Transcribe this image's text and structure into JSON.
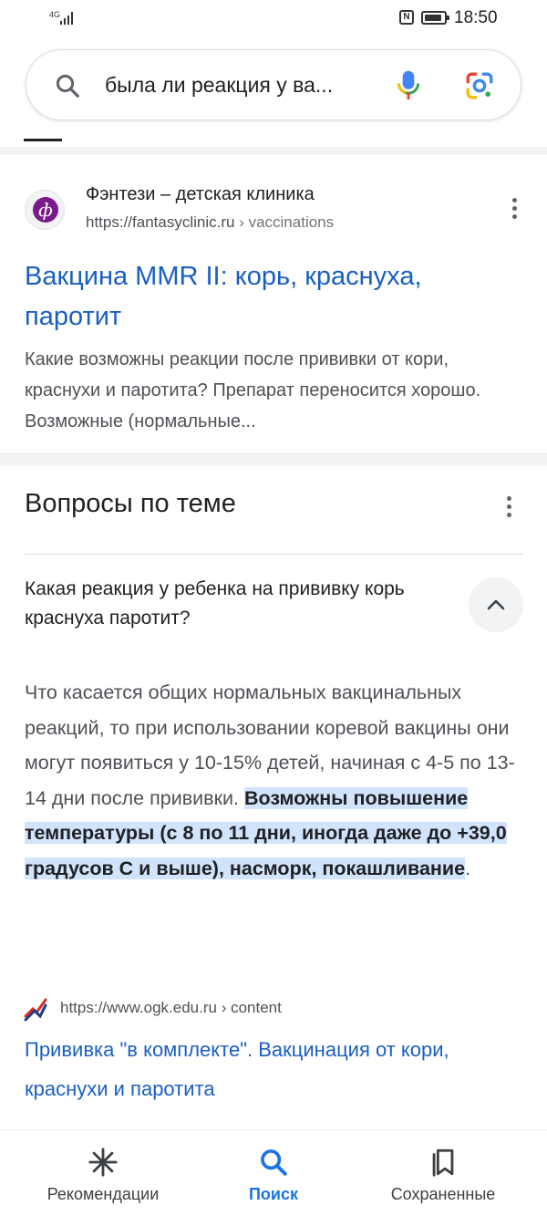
{
  "status_bar": {
    "network": "4G",
    "time": "18:50",
    "nfc": "N"
  },
  "search": {
    "query": "была ли реакция у ва..."
  },
  "result": {
    "favicon_letter": "ф",
    "site_name": "Фэнтези – детская клиника",
    "url": "https://fantasyclinic.ru",
    "url_crumb": " › vaccinations",
    "title": "Вакцина MMR II: корь, краснуха, паротит",
    "snippet": "Какие возможны реакции после прививки от кори, краснухи и паротита? Препарат переносится хорошо. Возможные (нормальные..."
  },
  "paa": {
    "heading": "Вопросы по теме",
    "question": "Какая реакция у ребенка на прививку корь краснуха паротит?",
    "answer_plain": "Что касается общих нормальных вакцинальных реакций, то при использовании коревой вакцины они могут появиться у 10-15% детей, начиная с 4-5 по 13-14 дни после прививки. ",
    "answer_highlight": "Возможны повышение температуры (с 8 по 11 дни, иногда даже до +39,0 градусов С и выше), насморк, покашливание",
    "answer_end": ".",
    "source_url": "https://www.ogk.edu.ru",
    "source_crumb": " › content",
    "source_title": "Прививка \"в комплекте\". Вакцинация от кори, краснухи и паротита"
  },
  "bottom_nav": {
    "items": [
      {
        "label": "Рекомендации",
        "icon": "asterisk-icon"
      },
      {
        "label": "Поиск",
        "icon": "search-icon",
        "active": true
      },
      {
        "label": "Сохраненные",
        "icon": "saved-icon"
      }
    ]
  },
  "colors": {
    "link": "#1a5fc3",
    "highlight": "#d2e3fc",
    "active_nav": "#1a73e8"
  }
}
